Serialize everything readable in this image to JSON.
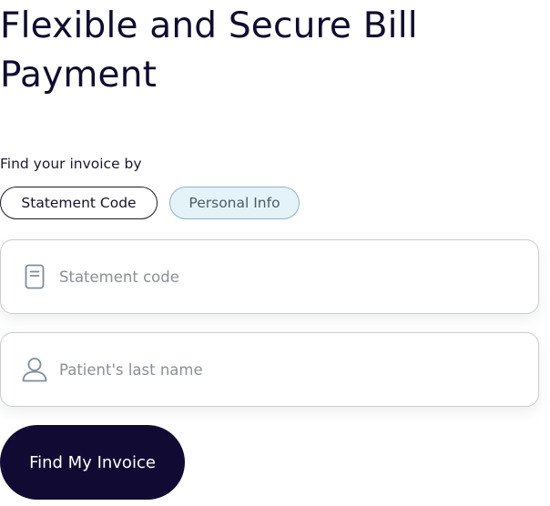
{
  "header": {
    "title": "Flexible and Secure Bill Payment"
  },
  "finder": {
    "label": "Find your invoice by",
    "options": [
      {
        "label": "Statement Code",
        "icon": ""
      },
      {
        "label": "Personal Info",
        "icon": ""
      }
    ],
    "selected": "Personal Info"
  },
  "fields": {
    "statement_code": {
      "placeholder": "Statement code",
      "value": "",
      "icon": "document-icon"
    },
    "last_name": {
      "placeholder": "Patient's last name",
      "value": "",
      "icon": "user-icon"
    }
  },
  "actions": {
    "submit_label": "Find My Invoice"
  },
  "colors": {
    "brand_dark": "#110b33",
    "selected_toggle_bg": "#e4f3f8",
    "field_border": "#c9cdd2"
  }
}
